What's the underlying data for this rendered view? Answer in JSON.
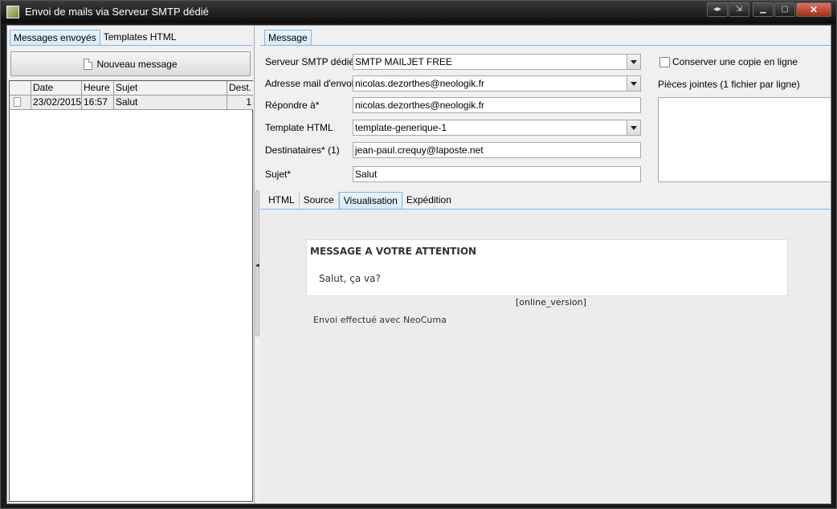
{
  "window": {
    "title": "Envoi de mails via Serveur SMTP dédié",
    "buttons": [
      "◂▸",
      "⇲",
      "▁",
      "▢",
      "✕"
    ]
  },
  "left": {
    "tabs": [
      {
        "label": "Messages envoyés",
        "active": true
      },
      {
        "label": "Templates HTML",
        "active": false
      }
    ],
    "new_button": "Nouveau message",
    "table": {
      "columns": [
        "",
        "Date",
        "Heure",
        "Sujet",
        "Dest."
      ],
      "rows": [
        {
          "date": "23/02/2015",
          "time": "16:57",
          "subject": "Salut",
          "dest": "1"
        }
      ]
    }
  },
  "right": {
    "tab": "Message",
    "form": {
      "smtp": {
        "label": "Serveur SMTP dédié*",
        "value": "SMTP MAILJET FREE"
      },
      "from": {
        "label": "Adresse mail d'envoi*",
        "value": "nicolas.dezorthes@neologik.fr"
      },
      "reply": {
        "label": "Répondre à*",
        "value": "nicolas.dezorthes@neologik.fr"
      },
      "template": {
        "label": "Template HTML",
        "value": "template-generique-1"
      },
      "recipients": {
        "label": "Destinataires* (1)",
        "value": "jean-paul.crequy@laposte.net"
      },
      "subject": {
        "label": "Sujet*",
        "value": "Salut"
      }
    },
    "keep_copy_label": "Conserver une copie en ligne",
    "attachments_label": "Pièces jointes (1 fichier par ligne)",
    "subtabs": [
      {
        "label": "HTML",
        "active": false
      },
      {
        "label": "Source",
        "active": false
      },
      {
        "label": "Visualisation",
        "active": true
      },
      {
        "label": "Expédition",
        "active": false
      }
    ],
    "preview": {
      "heading": "MESSAGE A VOTRE ATTENTION",
      "body": "Salut, ça va?",
      "online_version": "[online_version]",
      "footer": "Envoi effectué avec NeoCuma"
    }
  }
}
